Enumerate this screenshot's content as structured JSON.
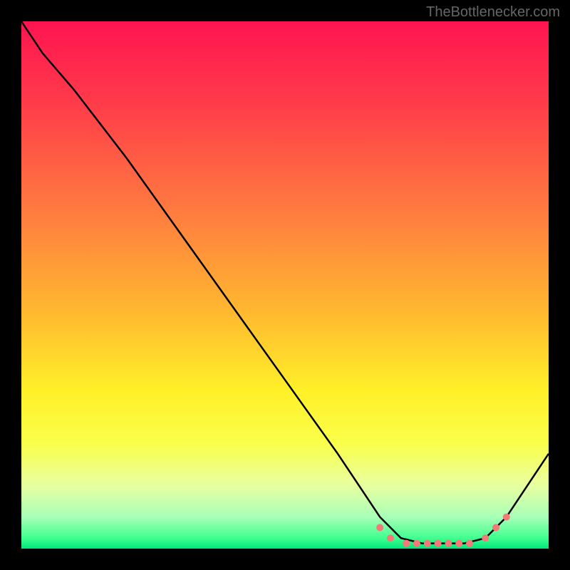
{
  "watermark": "TheBottlenecker.com",
  "chart_data": {
    "type": "line",
    "title": "",
    "xlabel": "",
    "ylabel": "",
    "xlim": [
      0,
      100
    ],
    "ylim": [
      0,
      100
    ],
    "gradient_stops": [
      {
        "offset": 0,
        "color": "#ff1450"
      },
      {
        "offset": 15,
        "color": "#ff3a4a"
      },
      {
        "offset": 35,
        "color": "#ff7840"
      },
      {
        "offset": 55,
        "color": "#ffb830"
      },
      {
        "offset": 70,
        "color": "#fff028"
      },
      {
        "offset": 80,
        "color": "#faff4a"
      },
      {
        "offset": 88,
        "color": "#e8ffa0"
      },
      {
        "offset": 94,
        "color": "#a8ffb8"
      },
      {
        "offset": 98,
        "color": "#40ff90"
      },
      {
        "offset": 100,
        "color": "#00e878"
      }
    ],
    "curve": {
      "x": [
        0,
        4,
        10,
        20,
        30,
        40,
        50,
        60,
        68,
        72,
        76,
        80,
        84,
        88,
        92,
        100
      ],
      "y": [
        100,
        94,
        87,
        74,
        60,
        46,
        32,
        18,
        6,
        2,
        1,
        1,
        1,
        2,
        6,
        18
      ]
    },
    "markers": {
      "x": [
        68,
        70,
        73,
        75,
        77,
        79,
        81,
        83,
        85,
        88,
        90,
        92
      ],
      "y": [
        4,
        2,
        1,
        1,
        1,
        1,
        1,
        1,
        1,
        2,
        4,
        6
      ],
      "color": "#f47a7a",
      "radius": 5
    }
  }
}
